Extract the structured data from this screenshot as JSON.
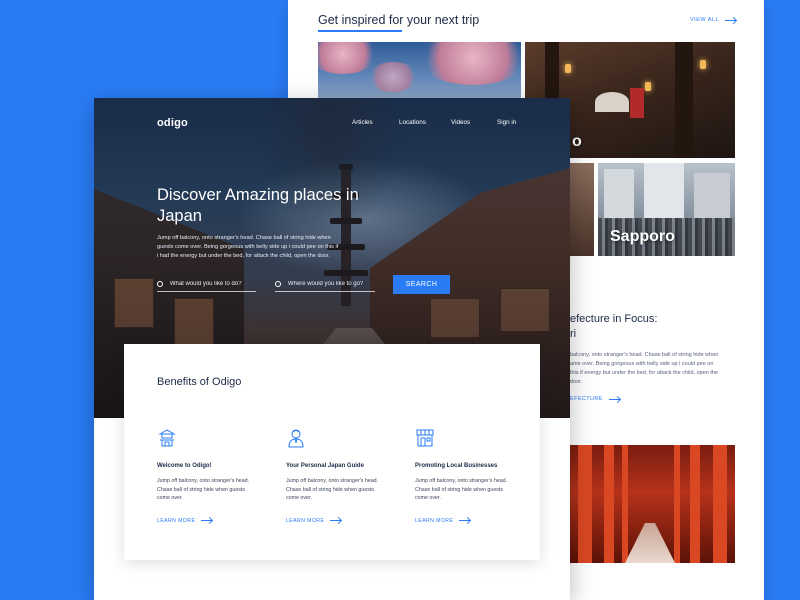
{
  "back_page": {
    "inspire_title": "Get inspired for your next trip",
    "view_all": "VIEW ALL",
    "tiles": {
      "city_partial_label": "o",
      "sapporo_label": "Sapporo"
    },
    "prefecture": {
      "title_line1": "efecture in Focus:",
      "title_line2": "ri",
      "body": "balcony, onto stranger's head. Chase ball of string hide when ame over. Being gorgeous with belly side up i could pee on this if energy but under the bed, for attack the child, open the door.",
      "link": "EFECTURE"
    }
  },
  "front_page": {
    "logo": "odigo",
    "nav": [
      "Articles",
      "Locations",
      "Videos",
      "Sign in"
    ],
    "hero": {
      "title": "Discover Amazing places in Japan",
      "text": "Jump off balcony, onto stranger's head. Chase ball of string hide when guests come over. Being gorgeous with belly side up i could pee on this if i had the energy but under the bed, for attack the child, open the door.",
      "search_what_placeholder": "What would you like to do?",
      "search_where_placeholder": "Where would you like to go?",
      "search_button": "SEARCH"
    },
    "benefits": {
      "title": "Benefits of Odigo",
      "items": [
        {
          "icon": "temple-icon",
          "title": "Welcome to Odigo!",
          "text": "Jump off balcony, onto stranger's head. Chase ball of string hide when guests come over.",
          "link": "LEARN MORE"
        },
        {
          "icon": "guide-person-icon",
          "title": "Your Personal Japan Guide",
          "text": "Jump off balcony, onto stranger's head. Chase ball of string hide when guests come over.",
          "link": "LEARN MORE"
        },
        {
          "icon": "shop-icon",
          "title": "Promoting Local Businesses",
          "text": "Jump off balcony, onto stranger's head. Chase ball of string hide when guests come over.",
          "link": "LEARN MORE"
        }
      ]
    }
  },
  "colors": {
    "background": "#2a7cf6",
    "accent": "#2a7cf6",
    "heading": "#1e2b48"
  }
}
